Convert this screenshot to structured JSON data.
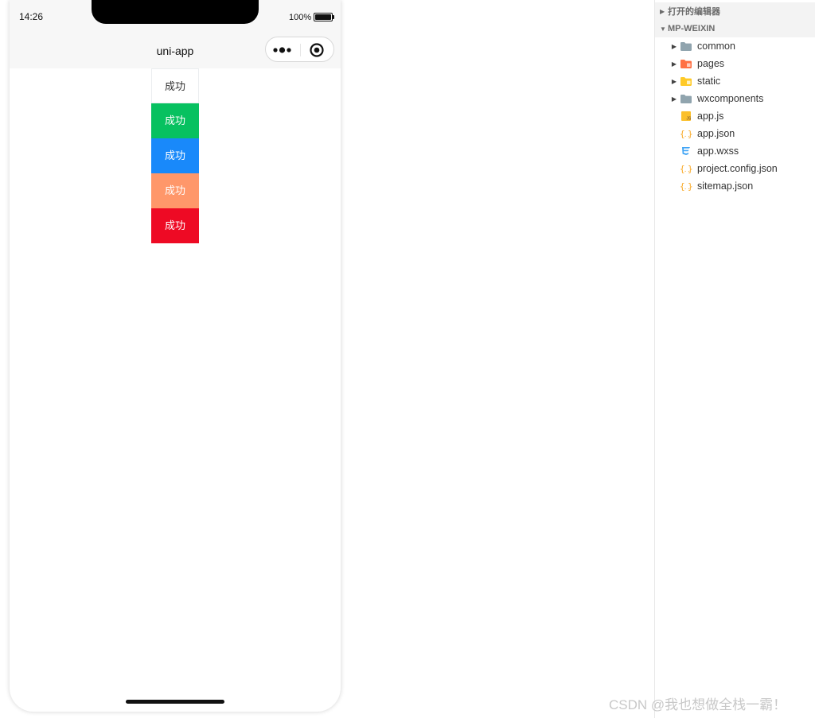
{
  "status_bar": {
    "time": "14:26",
    "battery": "100%"
  },
  "nav_bar": {
    "title": "uni-app"
  },
  "buttons": [
    {
      "label": "成功",
      "bg": "#ffffff",
      "color": "#333333"
    },
    {
      "label": "成功",
      "bg": "#07c160",
      "color": "#ffffff"
    },
    {
      "label": "成功",
      "bg": "#1989fa",
      "color": "#ffffff"
    },
    {
      "label": "成功",
      "bg": "#ff976a",
      "color": "#ffffff"
    },
    {
      "label": "成功",
      "bg": "#ee0a24",
      "color": "#ffffff"
    }
  ],
  "explorer": {
    "sections": [
      {
        "title": "打开的编辑器",
        "expanded": false
      },
      {
        "title": "MP-WEIXIN",
        "expanded": true
      }
    ],
    "items": [
      {
        "label": "common",
        "type": "folder",
        "icon": "folder-icon"
      },
      {
        "label": "pages",
        "type": "folder",
        "icon": "pages-folder-icon"
      },
      {
        "label": "static",
        "type": "folder",
        "icon": "static-folder-icon"
      },
      {
        "label": "wxcomponents",
        "type": "folder",
        "icon": "folder-icon"
      },
      {
        "label": "app.js",
        "type": "file",
        "icon": "js-file-icon"
      },
      {
        "label": "app.json",
        "type": "file",
        "icon": "json-file-icon"
      },
      {
        "label": "app.wxss",
        "type": "file",
        "icon": "css-file-icon"
      },
      {
        "label": "project.config.json",
        "type": "file",
        "icon": "json-file-icon"
      },
      {
        "label": "sitemap.json",
        "type": "file",
        "icon": "json-file-icon"
      }
    ]
  },
  "watermark": "CSDN @我也想做全栈一霸！"
}
